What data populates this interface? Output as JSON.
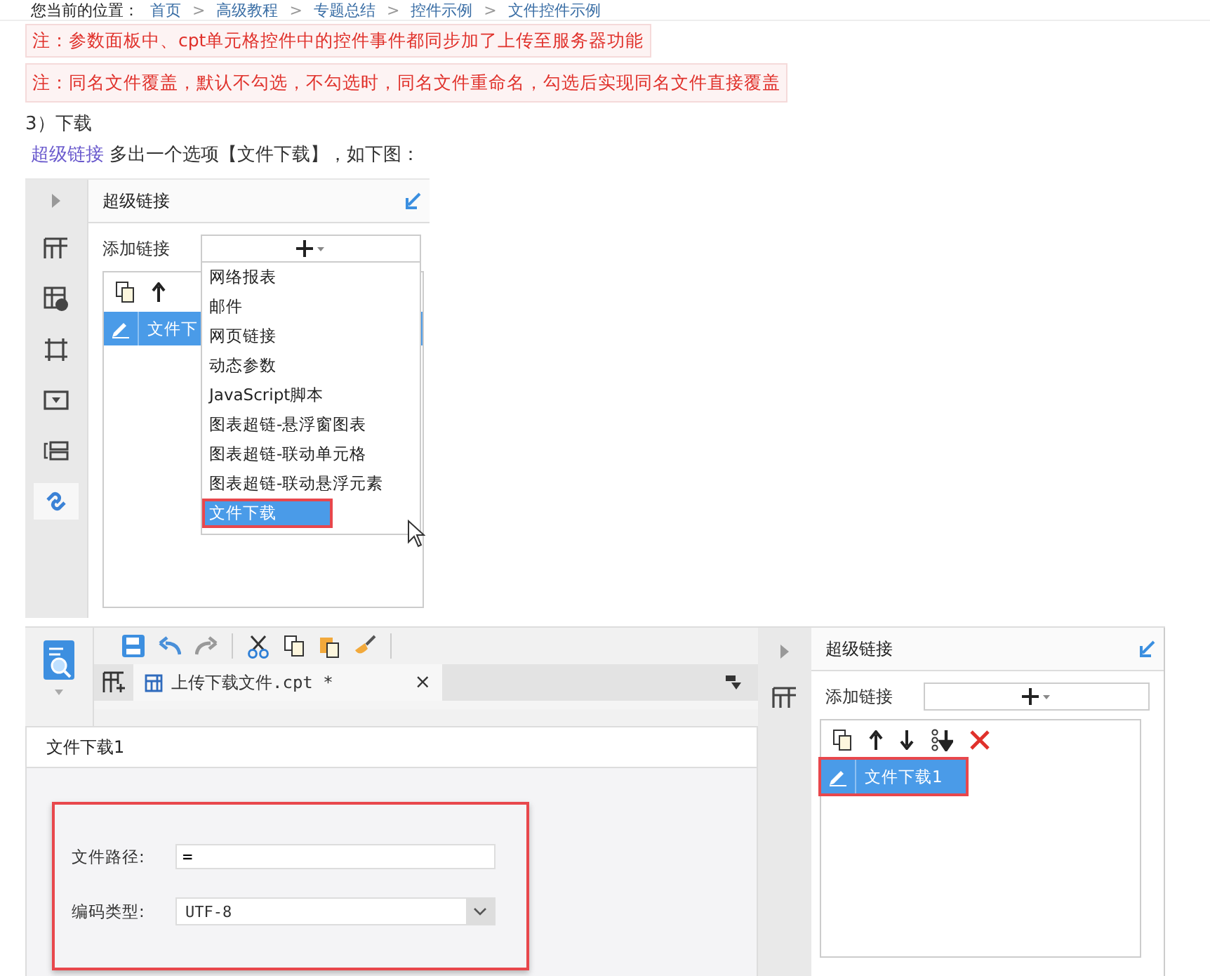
{
  "breadcrumb": [
    {
      "kind": "label",
      "text": "您当前的位置："
    },
    {
      "kind": "link",
      "text": "首页"
    },
    {
      "kind": "sep",
      "text": ">"
    },
    {
      "kind": "link",
      "text": "高级教程"
    },
    {
      "kind": "sep",
      "text": ">"
    },
    {
      "kind": "link",
      "text": "专题总结"
    },
    {
      "kind": "sep",
      "text": ">"
    },
    {
      "kind": "link",
      "text": "控件示例"
    },
    {
      "kind": "sep",
      "text": ">"
    },
    {
      "kind": "link",
      "text": "文件控件示例"
    }
  ],
  "notes": [
    "注：参数面板中、cpt单元格控件中的控件事件都同步加了上传至服务器功能",
    "注：同名文件覆盖，默认不勾选，不勾选时，同名文件重命名，勾选后实现同名文件直接覆盖"
  ],
  "heading": "3）下载",
  "intro": {
    "link": "超级链接",
    "text": "多出一个选项【文件下载】，如下图："
  },
  "figure_1": {
    "side_tabs": [
      {
        "selected": false
      },
      {
        "selected": false
      },
      {
        "selected": false
      },
      {
        "selected": false
      },
      {
        "selected": false
      },
      {
        "selected": true
      }
    ],
    "panel_title": "超级链接",
    "add_label": "添加链接",
    "rows": [
      {
        "text": "文件下",
        "selected": true
      }
    ],
    "menu": [
      {
        "text": "网络报表",
        "selected": false,
        "highlighted": false
      },
      {
        "text": "邮件",
        "selected": false,
        "highlighted": false
      },
      {
        "text": "网页链接",
        "selected": false,
        "highlighted": false
      },
      {
        "text": "动态参数",
        "selected": false,
        "highlighted": false
      },
      {
        "text": "JavaScript脚本",
        "selected": false,
        "highlighted": false
      },
      {
        "text": "图表超链-悬浮窗图表",
        "selected": false,
        "highlighted": false
      },
      {
        "text": "图表超链-联动单元格",
        "selected": false,
        "highlighted": false
      },
      {
        "text": "图表超链-联动悬浮元素",
        "selected": false,
        "highlighted": false
      },
      {
        "text": "文件下载",
        "selected": true,
        "highlighted": true
      }
    ]
  },
  "figure_2": {
    "tab": {
      "title": "上传下载文件.cpt *",
      "close": "×"
    },
    "dialog": {
      "title": "文件下载1",
      "fields": [
        {
          "kind": "text",
          "label": "文件路径:",
          "value": "="
        },
        {
          "kind": "select",
          "label": "编码类型:",
          "value": "UTF-8"
        }
      ]
    },
    "panel_title": "超级链接",
    "add_label": "添加链接",
    "rows": [
      {
        "text": "文件下载1",
        "selected": true,
        "highlighted": true
      }
    ]
  }
}
